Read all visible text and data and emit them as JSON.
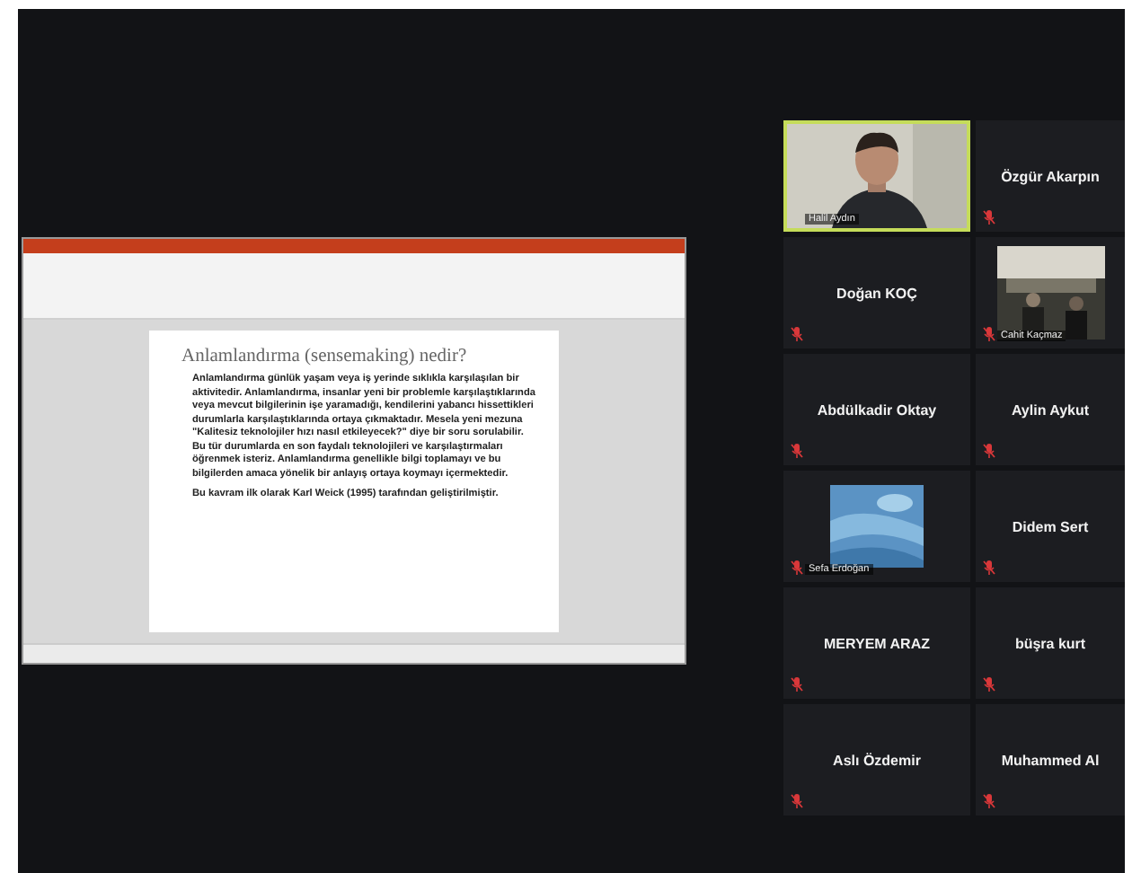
{
  "shared_screen": {
    "kind": "presentation",
    "slide": {
      "title": "Anlamlandırma (sensemaking) nedir?",
      "paragraphs": [
        "Anlamlandırma günlük yaşam veya iş yerinde sıklıkla karşılaşılan bir aktivitedir. Anlamlandırma, insanlar yeni bir problemle karşılaştıklarında veya mevcut bilgilerinin işe yaramadığı, kendilerini yabancı hissettikleri durumlarla karşılaştıklarında ortaya çıkmaktadır. Mesela yeni mezuna \"Kalitesiz teknolojiler hızı nasıl etkileyecek?\" diye bir soru sorulabilir. Bu tür durumlarda en son faydalı teknolojileri ve karşılaştırmaları öğrenmek isteriz. Anlamlandırma genellikle **bilgi toplamayı ve bu bilgilerden amaca yönelik bir anlayış ortaya koymayı** içermektedir.",
        "Bu kavram ilk olarak Karl Weick (1995) tarafından geliştirilmiştir."
      ]
    }
  },
  "participants": [
    {
      "name": "Halil Aydın",
      "kind": "video",
      "speaking": true,
      "muted": false
    },
    {
      "name": "Özgür Akarpın",
      "kind": "name",
      "speaking": false,
      "muted": true
    },
    {
      "name": "Doğan KOÇ",
      "kind": "name",
      "speaking": false,
      "muted": true
    },
    {
      "name": "Cahit Kaçmaz",
      "kind": "video",
      "speaking": false,
      "muted": true
    },
    {
      "name": "Abdülkadir Oktay",
      "kind": "name",
      "speaking": false,
      "muted": true
    },
    {
      "name": "Aylin Aykut",
      "kind": "name",
      "speaking": false,
      "muted": true
    },
    {
      "name": "Sefa Erdoğan",
      "kind": "video",
      "speaking": false,
      "muted": true
    },
    {
      "name": "Didem Sert",
      "kind": "name",
      "speaking": false,
      "muted": true
    },
    {
      "name": "MERYEM ARAZ",
      "kind": "name",
      "speaking": false,
      "muted": true
    },
    {
      "name": "büşra kurt",
      "kind": "name",
      "speaking": false,
      "muted": true
    },
    {
      "name": "Aslı Özdemir",
      "kind": "name",
      "speaking": false,
      "muted": true
    },
    {
      "name": "Muhammed Al",
      "kind": "name",
      "speaking": false,
      "muted": true
    }
  ]
}
